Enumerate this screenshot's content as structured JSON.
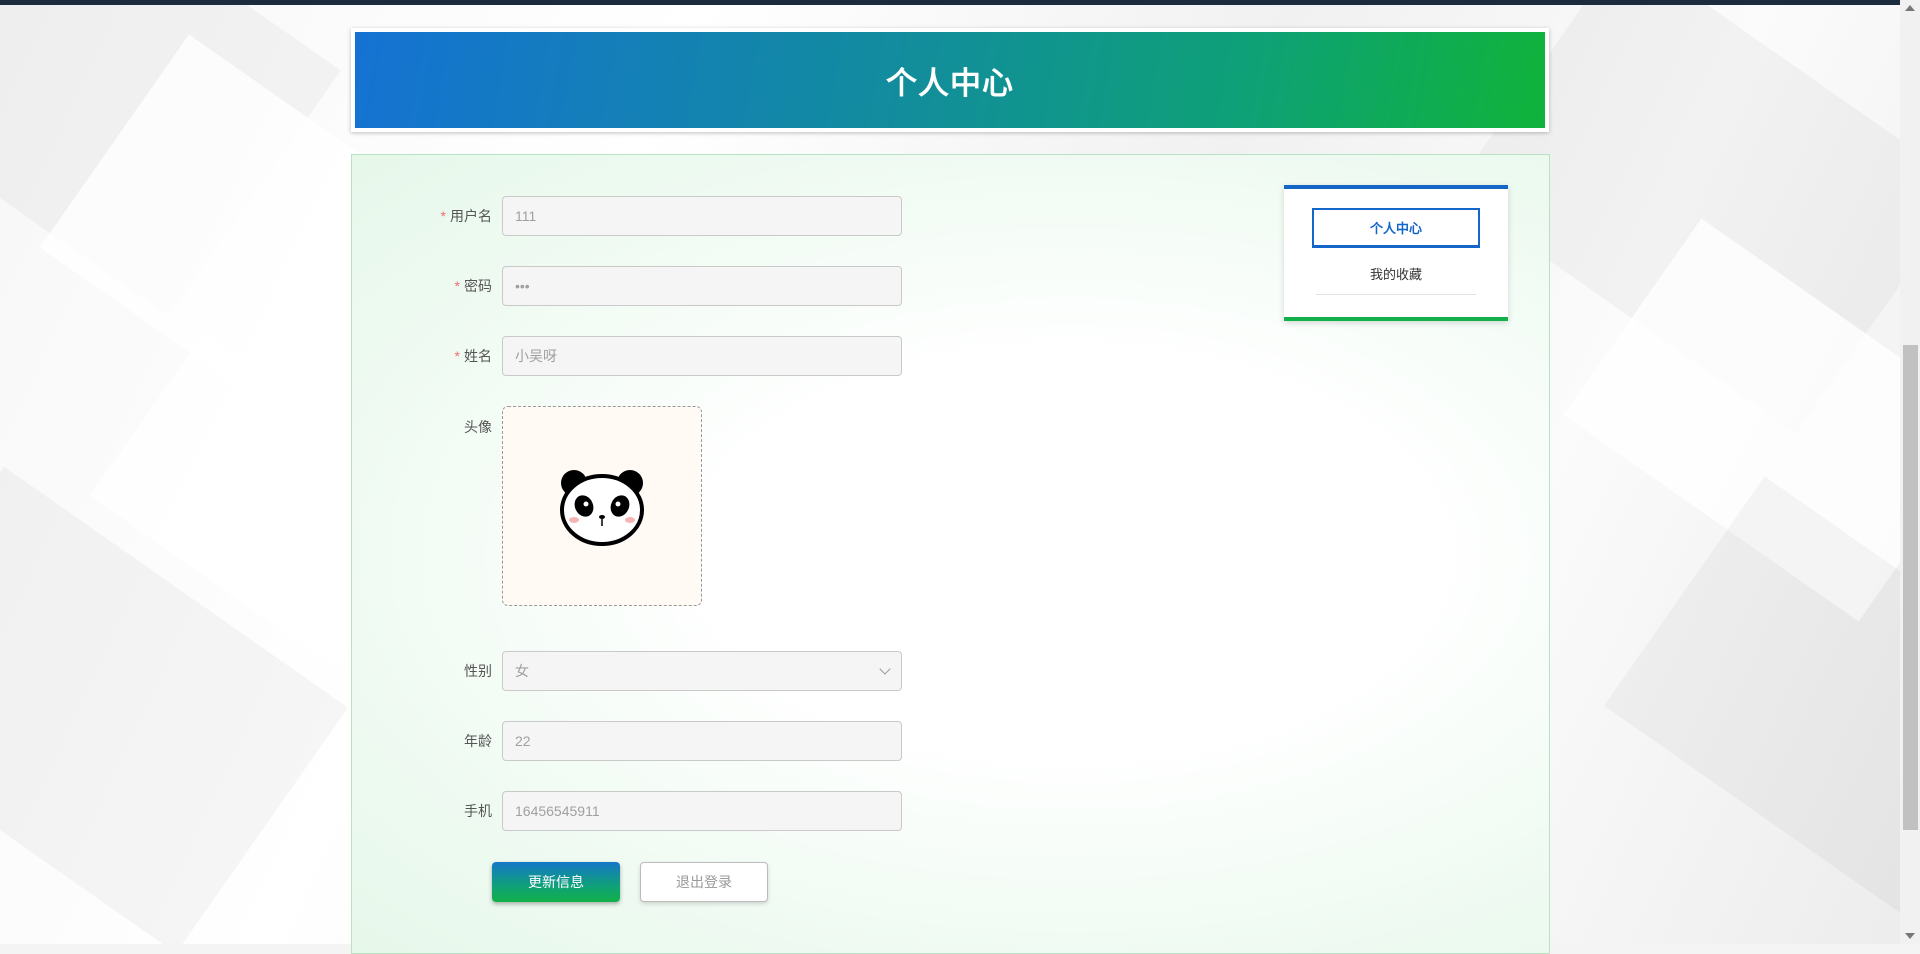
{
  "header": {
    "title": "个人中心"
  },
  "form": {
    "username": {
      "label": "用户名",
      "required": true,
      "value": "111"
    },
    "password": {
      "label": "密码",
      "required": true,
      "value": "•••"
    },
    "name": {
      "label": "姓名",
      "required": true,
      "value": "小吴呀"
    },
    "avatar": {
      "label": "头像",
      "icon": "panda-avatar"
    },
    "gender": {
      "label": "性别",
      "value": "女"
    },
    "age": {
      "label": "年龄",
      "value": "22"
    },
    "phone": {
      "label": "手机",
      "value": "16456545911"
    },
    "update_button": "更新信息",
    "logout_button": "退出登录"
  },
  "side_menu": {
    "items": [
      {
        "label": "个人中心",
        "active": true
      },
      {
        "label": "我的收藏",
        "active": false
      }
    ]
  },
  "colors": {
    "banner_start": "#1572d3",
    "banner_end": "#10b33a",
    "menu_accent": "#1466c8",
    "required": "#f56c6c"
  }
}
